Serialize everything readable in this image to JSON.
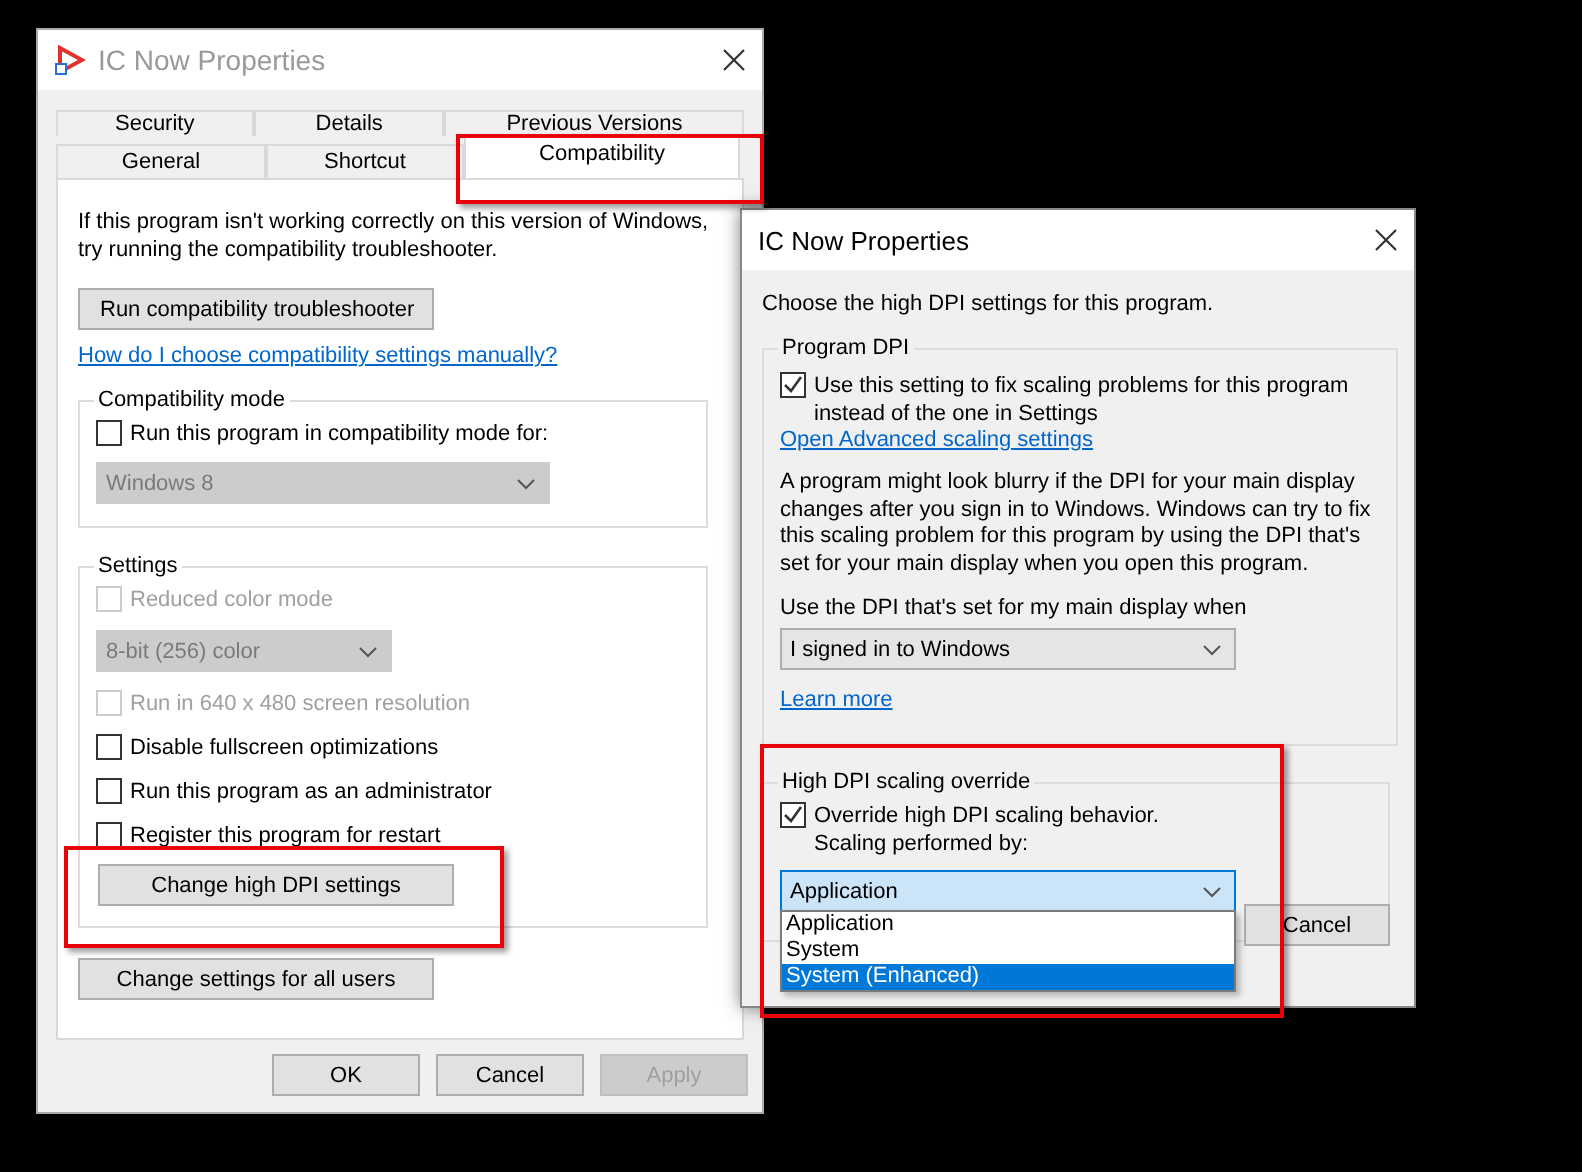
{
  "properties_window": {
    "title": "IC Now Properties",
    "tab_rows": [
      [
        {
          "label": "Security",
          "selected": false
        },
        {
          "label": "Details",
          "selected": false
        },
        {
          "label": "Previous Versions",
          "selected": false
        }
      ],
      [
        {
          "label": "General",
          "selected": false
        },
        {
          "label": "Shortcut",
          "selected": false
        },
        {
          "label": "Compatibility",
          "selected": true
        }
      ]
    ],
    "intro": "If this program isn't working correctly on this version of Windows, try running the compatibility troubleshooter.",
    "troubleshooter_button": "Run compatibility troubleshooter",
    "help_link": "How do I choose compatibility settings manually?",
    "compatibility_mode": {
      "title": "Compatibility mode",
      "checkbox": {
        "label": "Run this program in compatibility mode for:",
        "checked": false,
        "disabled": false
      },
      "dropdown": {
        "value": "Windows 8",
        "disabled": true
      }
    },
    "settings": {
      "title": "Settings",
      "items": [
        {
          "kind": "checkbox",
          "label": "Reduced color mode",
          "checked": false,
          "disabled": true
        },
        {
          "kind": "dropdown",
          "value": "8-bit (256) color",
          "disabled": true
        },
        {
          "kind": "checkbox",
          "label": "Run in 640 x 480 screen resolution",
          "checked": false,
          "disabled": true
        },
        {
          "kind": "checkbox",
          "label": "Disable fullscreen optimizations",
          "checked": false,
          "disabled": false
        },
        {
          "kind": "checkbox",
          "label": "Run this program as an administrator",
          "checked": false,
          "disabled": false
        },
        {
          "kind": "checkbox",
          "label": "Register this program for restart",
          "checked": false,
          "disabled": false
        },
        {
          "kind": "button",
          "label": "Change high DPI settings",
          "disabled": false
        }
      ]
    },
    "all_users_button": "Change settings for all users",
    "buttons": [
      {
        "label": "OK",
        "disabled": false
      },
      {
        "label": "Cancel",
        "disabled": false
      },
      {
        "label": "Apply",
        "disabled": true
      }
    ]
  },
  "dpi_window": {
    "title": "IC Now Properties",
    "intro": "Choose the high DPI settings for this program.",
    "program_dpi": {
      "title": "Program DPI",
      "checkbox": {
        "label": "Use this setting to fix scaling problems for this program instead of the one in Settings",
        "checked": true
      },
      "link": "Open Advanced scaling settings",
      "description": "A program might look blurry if the DPI for your main display changes after you sign in to Windows. Windows can try to fix this scaling problem for this program by using the DPI that's set for your main display when you open this program.",
      "dropdown_label": "Use the DPI that's set for my main display when",
      "dropdown": {
        "value": "I signed in to Windows"
      },
      "learn_more": "Learn more"
    },
    "override": {
      "title": "High DPI scaling override",
      "checkbox": {
        "label": "Override high DPI scaling behavior. Scaling performed by:",
        "checked": true
      },
      "dropdown": {
        "value": "Application",
        "expanded": true,
        "options": [
          {
            "label": "Application",
            "highlighted": false
          },
          {
            "label": "System",
            "highlighted": false
          },
          {
            "label": "System (Enhanced)",
            "highlighted": true
          }
        ]
      }
    },
    "buttons": [
      {
        "label": "Cancel"
      }
    ]
  }
}
